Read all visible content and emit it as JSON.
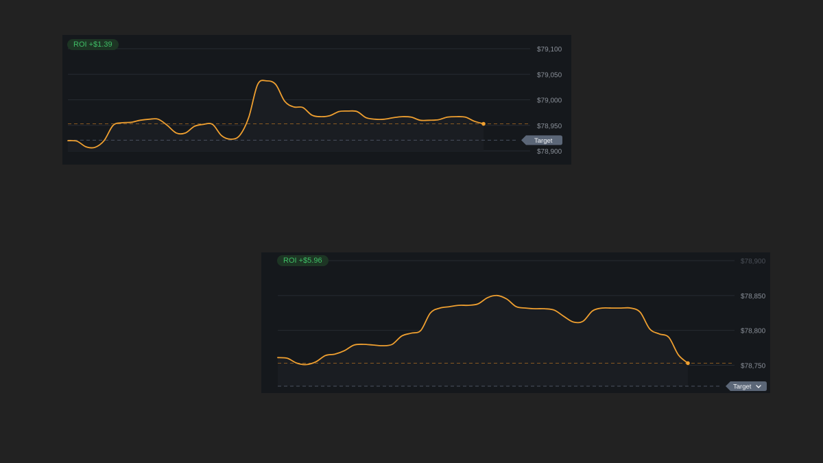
{
  "chart_data": [
    {
      "type": "line",
      "badge": {
        "label": "ROI",
        "value": "+$1.39"
      },
      "y_ticks": [
        79100,
        79050,
        79000,
        78950,
        78900
      ],
      "y_tick_labels": [
        "$79,100",
        "$79,050",
        "$79,000",
        "$78,950",
        "$78,900"
      ],
      "ylim": [
        78900,
        79100
      ],
      "grid": true,
      "current_value": 78953,
      "target_value": 78921,
      "target_label": "Target",
      "target_dropdown": false,
      "line_color": "#f0a030",
      "series": [
        {
          "values": [
            78920,
            78919,
            78908,
            78907,
            78920,
            78950,
            78955,
            78956,
            78960,
            78962,
            78962,
            78950,
            78935,
            78935,
            78948,
            78952,
            78952,
            78930,
            78923,
            78930,
            78965,
            79030,
            79037,
            79030,
            78997,
            78986,
            78985,
            78970,
            78967,
            78969,
            78977,
            78978,
            78977,
            78965,
            78962,
            78962,
            78965,
            78967,
            78966,
            78960,
            78960,
            78961,
            78966,
            78967,
            78966,
            78958,
            78953
          ]
        }
      ]
    },
    {
      "type": "line",
      "badge": {
        "label": "ROI",
        "value": "+$5.96"
      },
      "y_ticks": [
        78900,
        78850,
        78800,
        78750
      ],
      "y_tick_labels": [
        "$78,900",
        "$78,850",
        "$78,800",
        "$78,750"
      ],
      "ylim": [
        78720,
        78900
      ],
      "grid": true,
      "current_value": 78753,
      "target_value": 78720,
      "target_label": "Target",
      "target_dropdown": true,
      "line_color": "#f0a030",
      "series": [
        {
          "values": [
            78761,
            78760,
            78753,
            78751,
            78755,
            78764,
            78766,
            78771,
            78779,
            78780,
            78779,
            78778,
            78780,
            78792,
            78796,
            78800,
            78825,
            78832,
            78834,
            78836,
            78836,
            78838,
            78847,
            78850,
            78845,
            78834,
            78832,
            78831,
            78831,
            78829,
            78820,
            78812,
            78813,
            78828,
            78832,
            78832,
            78832,
            78832,
            78826,
            78802,
            78795,
            78790,
            78765,
            78753
          ]
        }
      ]
    }
  ]
}
